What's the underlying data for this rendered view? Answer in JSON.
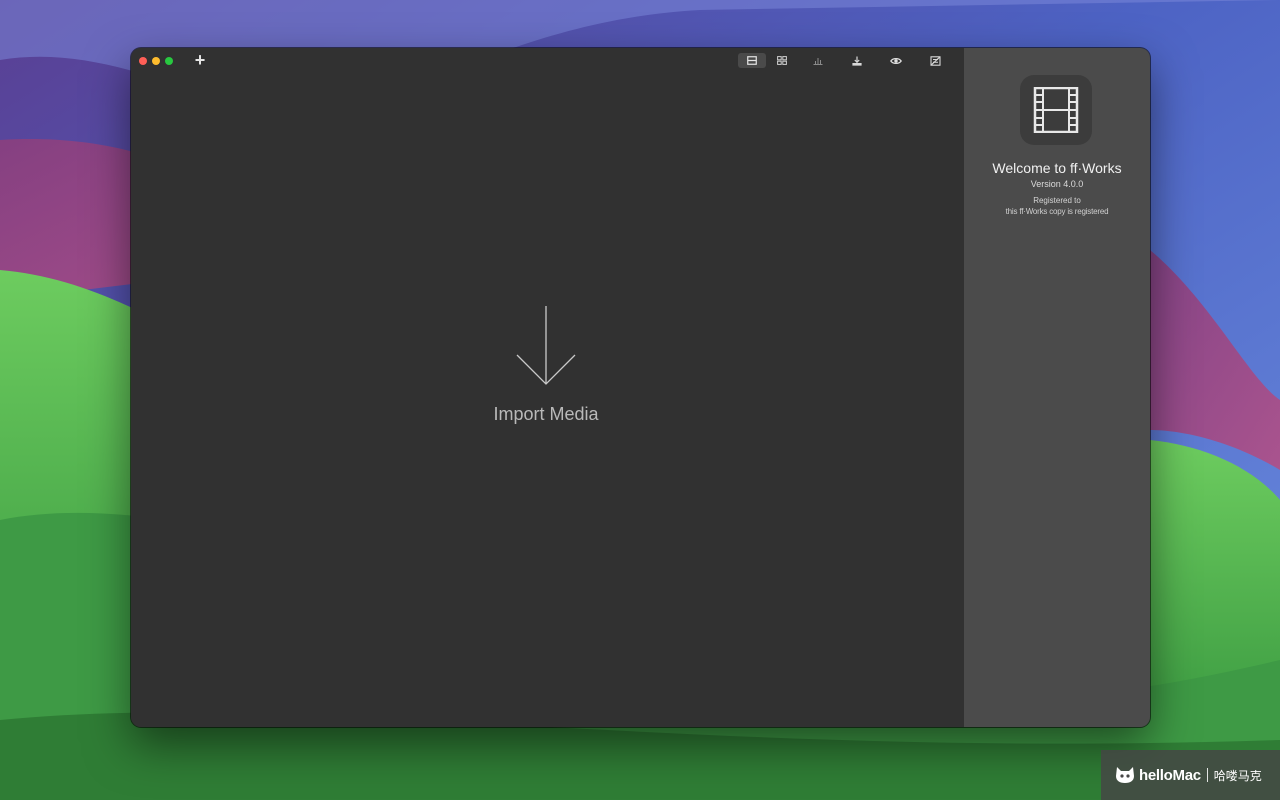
{
  "toolbar": {
    "add_label": "+",
    "icons": [
      "filmstrip-icon",
      "grid-icon",
      "histogram-icon",
      "export-icon",
      "preview-eye-icon",
      "strikethrough-icon"
    ],
    "active_icon": "filmstrip-icon"
  },
  "drop_zone": {
    "label": "Import Media",
    "icon": "arrow-down-icon"
  },
  "welcome": {
    "icon": "film-icon",
    "title": "Welcome to ff·Works",
    "version": "Version 4.0.0",
    "registered_label": "Registered to",
    "registered_name": "this ff·Works copy is registered"
  },
  "watermark": {
    "brand": "helloMac",
    "chinese": "哈喽马克"
  },
  "colors": {
    "main_bg": "#313131",
    "side_panel_bg": "#4b4b4b",
    "close": "#ff5f57",
    "minimize": "#febc2e",
    "maximize": "#28c840"
  }
}
